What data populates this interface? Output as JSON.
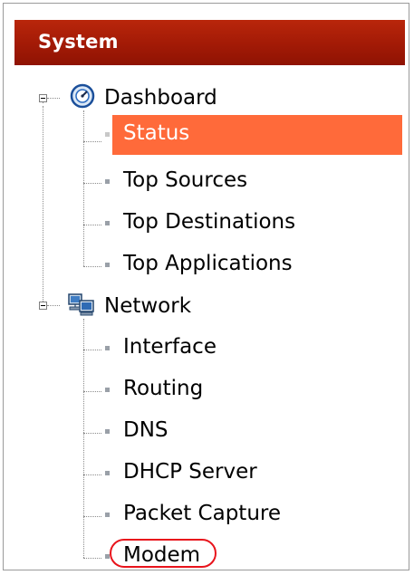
{
  "header": {
    "title": "System"
  },
  "tree": {
    "groups": [
      {
        "label": "Dashboard",
        "icon": "dashboard-gauge-icon",
        "expanded": true,
        "items": [
          {
            "label": "Status",
            "selected": true
          },
          {
            "label": "Top Sources"
          },
          {
            "label": "Top Destinations"
          },
          {
            "label": "Top Applications"
          }
        ]
      },
      {
        "label": "Network",
        "icon": "network-computers-icon",
        "expanded": true,
        "items": [
          {
            "label": "Interface"
          },
          {
            "label": "Routing"
          },
          {
            "label": "DNS"
          },
          {
            "label": "DHCP Server"
          },
          {
            "label": "Packet Capture"
          },
          {
            "label": "Modem",
            "highlighted": true
          }
        ]
      }
    ]
  },
  "colors": {
    "header_bg": "#a21a06",
    "selected_bg": "#ff6a3a",
    "highlight_circle": "#e8141c"
  }
}
